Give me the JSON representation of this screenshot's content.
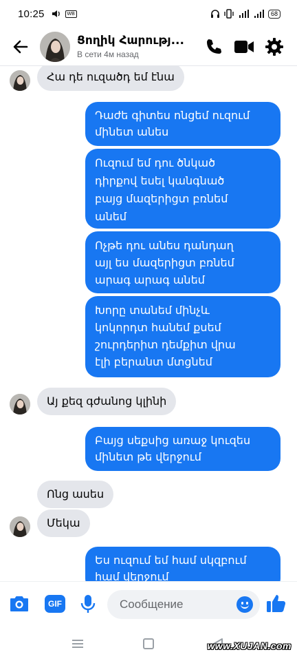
{
  "status_bar": {
    "time": "10:25",
    "battery": "68"
  },
  "header": {
    "contact_name": "Ցողիկ Հարությ...",
    "contact_status": "В сети 4м назад"
  },
  "messages": [
    {
      "side": "in",
      "text": "Հա դե ուզածդ եմ էնա"
    },
    {
      "side": "out",
      "lines": [
        "Դաժե գիտես ոնցեմ ուզում",
        "մինետ անես"
      ]
    },
    {
      "side": "out",
      "lines": [
        "Ուզում եմ դու ծնկած",
        "դիրքով եսել կանգնած",
        "բայց մազերիցտ բռնեմ",
        "անեմ"
      ]
    },
    {
      "side": "out",
      "lines": [
        "Ոչթե դու անես դանդաղ",
        "այլ ես մազերիցտ բռնեմ",
        "արագ արագ անեմ"
      ]
    },
    {
      "side": "out",
      "lines": [
        "Խորը տանեմ մինչև",
        "կոկորդտ հանեմ քսեմ",
        "շուրդերիտ դեմքիտ վրա",
        "էլի բերանտ մտցնեմ"
      ]
    },
    {
      "side": "in",
      "text": "Այ քեզ գժանոց կլինի"
    },
    {
      "side": "out",
      "lines": [
        "Բայց սեքսից առաջ կուզես",
        "մինետ թե վերջում"
      ]
    },
    {
      "side": "in",
      "text": "Ոնց ասես"
    },
    {
      "side": "in",
      "text": "Մեկա"
    },
    {
      "side": "out",
      "lines": [
        "Ես ուզում եմ համ սկզբում",
        "համ վերջում"
      ]
    }
  ],
  "composer": {
    "gif_label": "GIF",
    "placeholder": "Сообщение"
  },
  "watermark": "www.XUJAN.com",
  "colors": {
    "accent": "#1877f2",
    "incoming_bubble": "#e4e6eb"
  }
}
